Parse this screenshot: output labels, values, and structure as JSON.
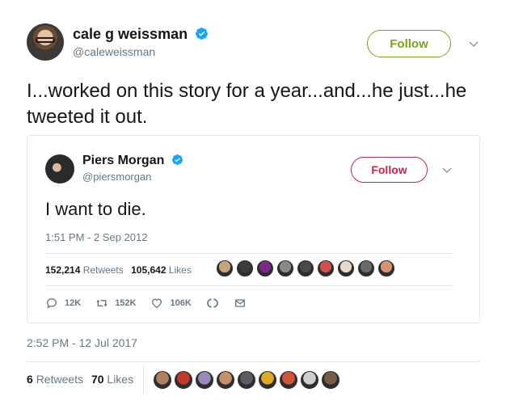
{
  "tweet": {
    "author": {
      "name": "cale g weissman",
      "handle": "@caleweissman",
      "verified": true
    },
    "follow_label": "Follow",
    "follow_color": "#79a31f",
    "text": "I...worked on this story for a year...and...he just...he tweeted it out.",
    "timestamp": "2:52 PM - 12 Jul 2017",
    "retweets_count": "6",
    "retweets_label": "Retweets",
    "likes_count": "70",
    "likes_label": "Likes",
    "liker_faces": [
      "#b08060",
      "#c23a2a",
      "#9a8ab8",
      "#c98e6a",
      "#5a5d63",
      "#e0a828",
      "#d2553a",
      "#cfcfcf",
      "#7a5a48"
    ]
  },
  "quoted": {
    "author": {
      "name": "Piers Morgan",
      "handle": "@piersmorgan",
      "verified": true
    },
    "follow_label": "Follow",
    "follow_color": "#c1284b",
    "text": "I want to die.",
    "timestamp": "1:51 PM - 2 Sep 2012",
    "retweets_count": "152,214",
    "retweets_label": "Retweets",
    "likes_count": "105,642",
    "likes_label": "Likes",
    "liker_faces": [
      "#c9a37c",
      "#3c3c3c",
      "#7a2a8a",
      "#8a8a8a",
      "#4a4a4a",
      "#d14e4e",
      "#e8d8c8",
      "#6a6a6a",
      "#d69470"
    ],
    "actions": {
      "reply_count": "12K",
      "retweet_count": "152K",
      "like_count": "106K"
    }
  },
  "icons": [
    "verified-badge-icon",
    "chevron-down-icon",
    "reply-icon",
    "retweet-icon",
    "heart-icon",
    "moments-icon",
    "dm-icon"
  ],
  "accent": "#1da1f2"
}
